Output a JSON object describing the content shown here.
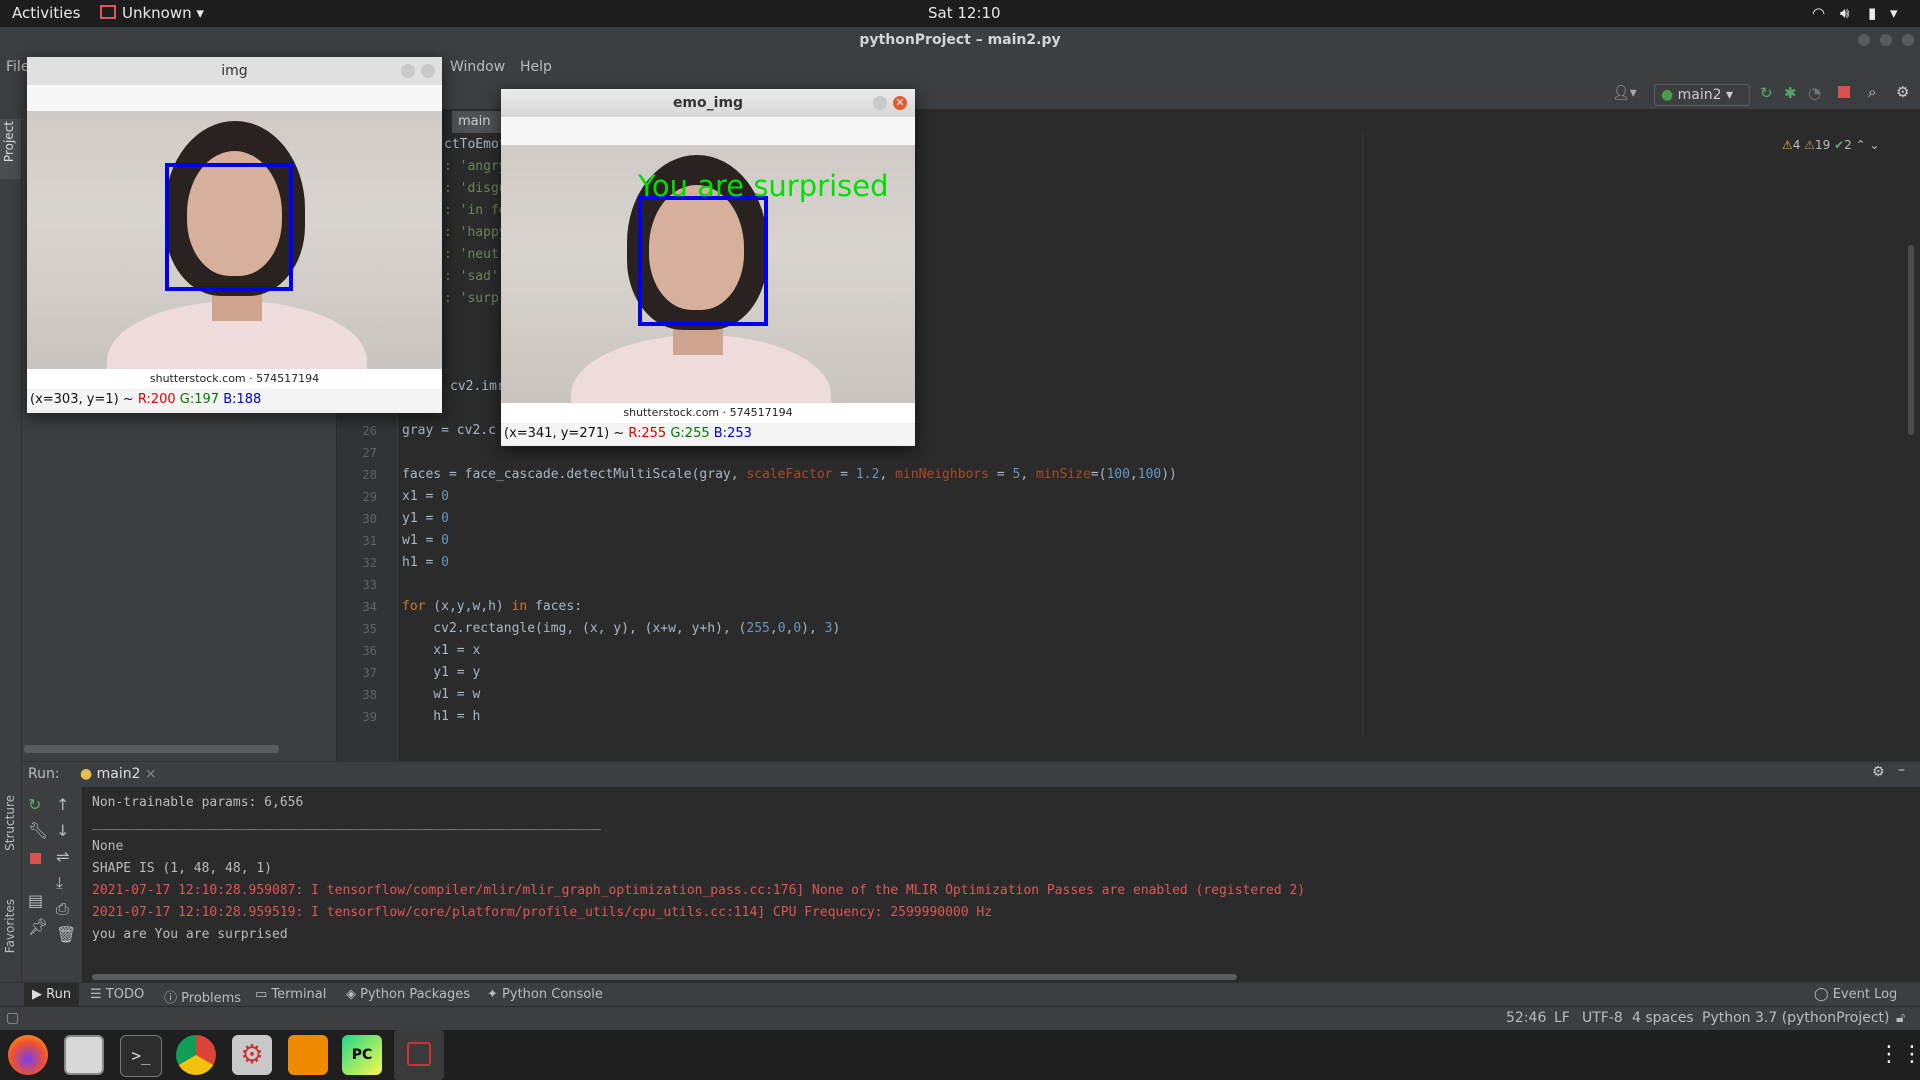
{
  "topbar": {
    "activities": "Activities",
    "app_menu": "Unknown",
    "clock": "Sat 12:10"
  },
  "ide": {
    "title": "pythonProject – main2.py",
    "menu_file": "File",
    "menu_window": "Window",
    "menu_help": "Help",
    "project_tab": "Project",
    "editor_tab": "main",
    "run_config": "main2",
    "inspections": {
      "warnings": "4",
      "weak_warnings": "19",
      "ok": "2"
    }
  },
  "code": {
    "partial": [
      "ctToEmoti",
      ": 'angry",
      ": 'disgu",
      ": 'in fe",
      ": 'happy",
      ": 'neutr",
      ": 'sad'",
      ": 'surpr",
      "cv2.imr"
    ],
    "line_numbers": [
      "26",
      "27",
      "28",
      "29",
      "30",
      "31",
      "32",
      "33",
      "34",
      "35",
      "36",
      "37",
      "38",
      "39"
    ],
    "l26": "gray = cv2.c",
    "l28a": "faces = face_cascade.detectMultiScale(gray, ",
    "l28b": "scaleFactor",
    "l28c": " = ",
    "l28d": "1.2",
    "l28e": ", ",
    "l28f": "minNeighbors",
    "l28g": " = ",
    "l28h": "5",
    "l28i": ", ",
    "l28j": "minSize",
    "l28k": "=(",
    "l28l": "100",
    "l28m": ",",
    "l28n": "100",
    "l28o": "))",
    "l29a": "x1 = ",
    "l29b": "0",
    "l30a": "y1 = ",
    "l30b": "0",
    "l31a": "w1 = ",
    "l31b": "0",
    "l32a": "h1 = ",
    "l32b": "0",
    "l34a": "for",
    "l34b": " (x,y,w,h) ",
    "l34c": "in",
    "l34d": " faces:",
    "l35a": "    cv2.rectangle(img, (x, y), (x+w, y+h), (",
    "l35b": "255",
    "l35c": ",",
    "l35d": "0",
    "l35e": ",",
    "l35f": "0",
    "l35g": "), ",
    "l35h": "3",
    "l35i": ")",
    "l36": "    x1 = x",
    "l37": "    y1 = y",
    "l38": "    w1 = w",
    "l39": "    h1 = h"
  },
  "run": {
    "label": "Run:",
    "tab": "main2",
    "lines": [
      {
        "text": "Non-trainable params: 6,656",
        "color": "#bbbbbb"
      },
      {
        "text": "_________________________________________________________________",
        "color": "#bbbbbb"
      },
      {
        "text": "None",
        "color": "#bbbbbb"
      },
      {
        "text": "SHAPE IS (1, 48, 48, 1)",
        "color": "#bbbbbb"
      },
      {
        "text": "2021-07-17 12:10:28.959087: I tensorflow/compiler/mlir/mlir_graph_optimization_pass.cc:176] None of the MLIR Optimization Passes are enabled (registered 2)",
        "color": "#e05555"
      },
      {
        "text": "2021-07-17 12:10:28.959519: I tensorflow/core/platform/profile_utils/cpu_utils.cc:114] CPU Frequency: 2599990000 Hz",
        "color": "#e05555"
      },
      {
        "text": "you are You are surprised",
        "color": "#bbbbbb"
      }
    ]
  },
  "side_tabs": {
    "structure": "Structure",
    "favorites": "Favorites"
  },
  "bottom_tabs": {
    "run": "Run",
    "todo": "TODO",
    "problems": "Problems",
    "terminal": "Terminal",
    "packages": "Python Packages",
    "console": "Python Console",
    "event_log": "Event Log"
  },
  "status": {
    "pos": "52:46",
    "eol": "LF",
    "enc": "UTF-8",
    "indent": "4 spaces",
    "interp": "Python 3.7 (pythonProject)"
  },
  "win_img": {
    "title": "img",
    "credit": "shutterstock.com · 574517194",
    "coords": "(x=303, y=1) ~ ",
    "r": "R:200",
    "g": "G:197",
    "b": "B:188"
  },
  "win_emo": {
    "title": "emo_img",
    "overlay": "You are surprised",
    "credit": "shutterstock.com · 574517194",
    "coords": "(x=341, y=271) ~ ",
    "r": "R:255",
    "g": "G:255",
    "b": "B:253"
  },
  "colors": {
    "accent_green": "#00e000",
    "bbox_blue": "#0000ee",
    "error_red": "#e05555"
  }
}
